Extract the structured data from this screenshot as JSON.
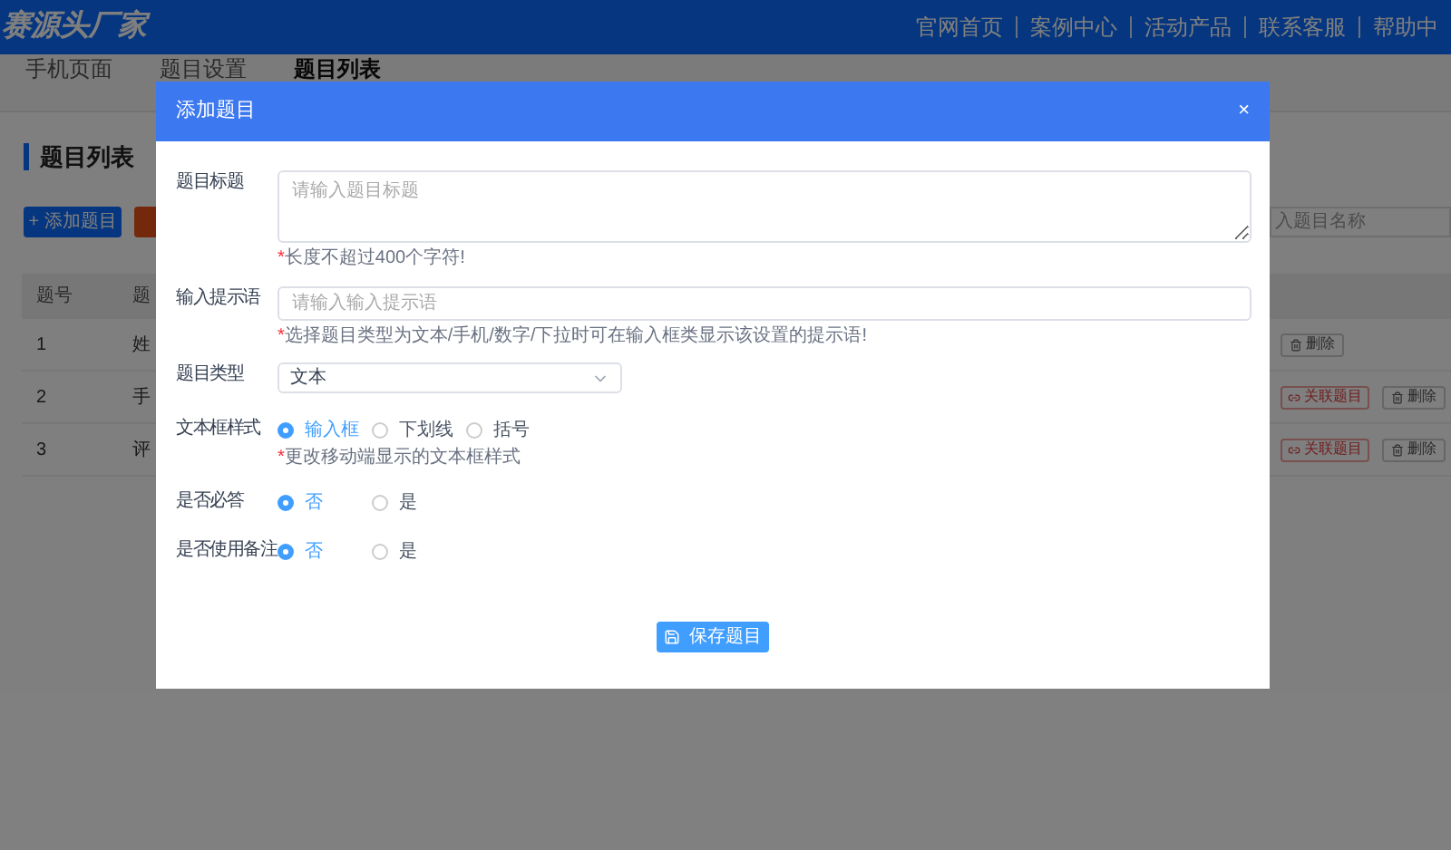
{
  "header": {
    "logo": "赛源头厂家",
    "links": [
      "官网首页",
      "案例中心",
      "活动产品",
      "联系客服",
      "帮助中"
    ]
  },
  "tabs": [
    {
      "label": "手机页面",
      "selected": false
    },
    {
      "label": "题目设置",
      "selected": false
    },
    {
      "label": "题目列表",
      "selected": true
    }
  ],
  "page_title": "题目列表",
  "toolbar": {
    "add_button": "+ 添加题目",
    "search_placeholder": "入题目名称"
  },
  "table": {
    "columns": [
      "题号",
      "题"
    ],
    "rows": [
      {
        "cells": [
          "1",
          "姓"
        ],
        "actions": [
          {
            "kind": "delete",
            "label": "删除"
          }
        ]
      },
      {
        "cells": [
          "2",
          "手"
        ],
        "actions": [
          {
            "kind": "link",
            "label": "关联题目"
          },
          {
            "kind": "delete",
            "label": "删除"
          }
        ]
      },
      {
        "cells": [
          "3",
          "评"
        ],
        "actions": [
          {
            "kind": "link",
            "label": "关联题目"
          },
          {
            "kind": "delete",
            "label": "删除"
          }
        ]
      }
    ]
  },
  "dialog": {
    "title": "添加题目",
    "close": "×",
    "save_button": "保存题目",
    "fields": [
      {
        "kind": "textarea",
        "label": "题目标题",
        "placeholder": "请输入题目标题",
        "hint_mark": "*",
        "hint": "长度不超过400个字符!"
      },
      {
        "kind": "input",
        "label": "输入提示语",
        "placeholder": "请输入输入提示语",
        "hint_mark": "*",
        "hint": "选择题目类型为文本/手机/数字/下拉时可在输入框类显示该设置的提示语!"
      },
      {
        "kind": "select",
        "label": "题目类型",
        "value": "文本"
      },
      {
        "kind": "radio",
        "label": "文本框样式",
        "options": [
          {
            "label": "输入框",
            "selected": true
          },
          {
            "label": "下划线",
            "selected": false
          },
          {
            "label": "括号",
            "selected": false
          }
        ],
        "hint_mark": "*",
        "hint": "更改移动端显示的文本框样式"
      },
      {
        "kind": "radio",
        "label": "是否必答",
        "options": [
          {
            "label": "否",
            "selected": true
          },
          {
            "label": "是",
            "selected": false
          }
        ]
      },
      {
        "kind": "radio",
        "label": "是否使用备注",
        "options": [
          {
            "label": "否",
            "selected": true
          },
          {
            "label": "是",
            "selected": false
          }
        ]
      }
    ]
  }
}
